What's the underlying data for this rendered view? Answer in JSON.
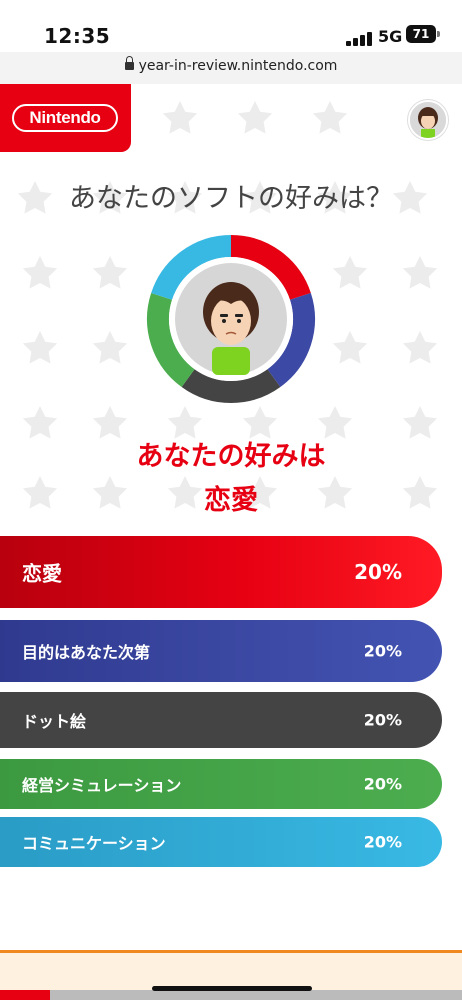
{
  "status_bar": {
    "time": "12:35",
    "network": "5G",
    "battery": "71"
  },
  "browser": {
    "url": "year-in-review.nintendo.com"
  },
  "header": {
    "logo_text": "Nintendo"
  },
  "main": {
    "question": "あなたのソフトの好みは？",
    "result_prefix": "あなたの好みは",
    "result_value": "恋愛"
  },
  "preferences": [
    {
      "label": "恋愛",
      "percent": "20%",
      "color": "#e60012"
    },
    {
      "label": "目的はあなた次第",
      "percent": "20%",
      "color": "#3d4aa5"
    },
    {
      "label": "ドット絵",
      "percent": "20%",
      "color": "#444444"
    },
    {
      "label": "経営シミュレーション",
      "percent": "20%",
      "color": "#4cad4f"
    },
    {
      "label": "コミュニケーション",
      "percent": "20%",
      "color": "#38b9e4"
    }
  ],
  "icons": {
    "lock": "lock-icon",
    "signal": "signal-icon",
    "battery": "battery-icon",
    "avatar": "mii-avatar"
  }
}
